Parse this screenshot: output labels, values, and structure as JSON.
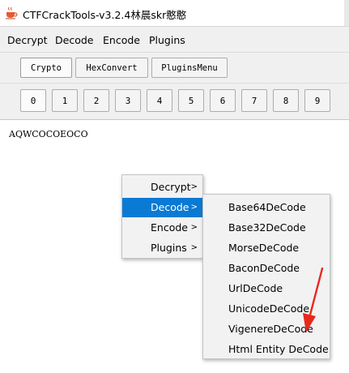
{
  "window": {
    "title": "CTFCrackTools-v3.2.4林晨skr憨憨"
  },
  "menubar": {
    "items": [
      "Decrypt",
      "Decode",
      "Encode",
      "Plugins"
    ]
  },
  "tabs": {
    "labels": [
      "Crypto",
      "HexConvert",
      "PluginsMenu"
    ],
    "active_index": 0
  },
  "number_tabs": {
    "labels": [
      "0",
      "1",
      "2",
      "3",
      "4",
      "5",
      "6",
      "7",
      "8",
      "9"
    ],
    "active_index": 0
  },
  "editor": {
    "content": "AQWCOCOEOCO"
  },
  "context_menu": {
    "items": [
      "Decrypt",
      "Decode",
      "Encode",
      "Plugins"
    ],
    "highlighted": "Decode",
    "arrow_glyph": ">"
  },
  "submenu": {
    "items": [
      "Base64DeCode",
      "Base32DeCode",
      "MorseDeCode",
      "BaconDeCode",
      "UrlDeCode",
      "UnicodeDeCode",
      "VigenereDeCode",
      "Html Entity DeCode"
    ]
  },
  "colors": {
    "highlight": "#0a7ad4",
    "annotation_arrow": "#e8281d"
  },
  "icons": {
    "app": "coffee-cup-icon",
    "annotation": "red-arrow-icon"
  }
}
